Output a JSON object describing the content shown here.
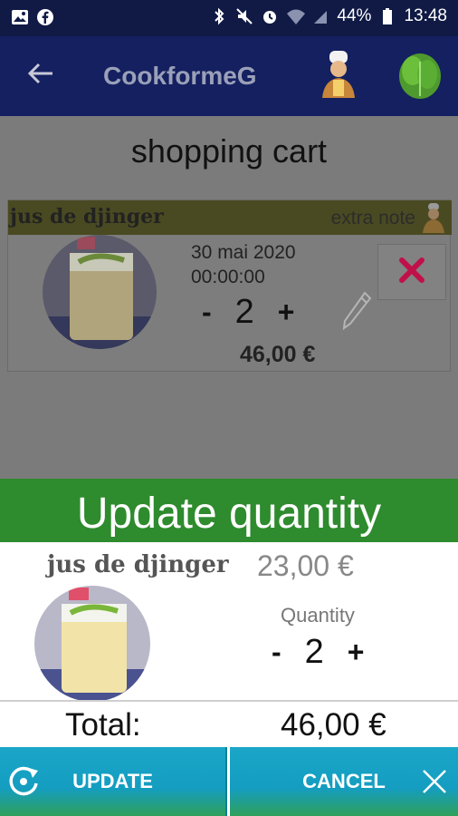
{
  "status_bar": {
    "battery_percent": "44%",
    "time": "13:48",
    "icons_left": [
      "image-icon",
      "facebook-icon"
    ],
    "icons_right": [
      "bluetooth-icon",
      "mute-icon",
      "alarm-icon",
      "wifi-icon",
      "signal-icon",
      "battery-icon"
    ]
  },
  "app_bar": {
    "title": "CookformeG",
    "back_icon": "arrow-left-icon",
    "chef_icon": "chef-icon",
    "logo_icon": "lettuce-icon"
  },
  "page": {
    "title": "shopping cart"
  },
  "cart_item": {
    "name": "jus de djinger",
    "extra_note_label": "extra note",
    "date": "30 mai 2020",
    "time": "00:00:00",
    "minus_label": "-",
    "quantity": "2",
    "plus_label": "+",
    "price": "46,00 €"
  },
  "dialog": {
    "title": "Update quantity",
    "product_name": "jus de djinger",
    "unit_price": "23,00 €",
    "quantity_label": "Quantity",
    "minus_label": "-",
    "quantity": "2",
    "plus_label": "+",
    "total_label": "Total:",
    "total_value": "46,00 €",
    "update_label": "UPDATE",
    "cancel_label": "CANCEL"
  },
  "colors": {
    "status_bar": "#101a45",
    "app_bar": "#142060",
    "dialog_title": "#2e8b2e",
    "button": "#1aa6c8",
    "delete": "#c0104a"
  }
}
